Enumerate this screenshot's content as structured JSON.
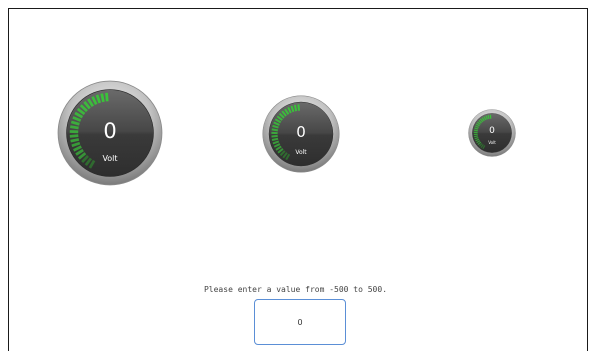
{
  "gauges": [
    {
      "id": "large",
      "value": "0",
      "unit": "Volt",
      "level": 0
    },
    {
      "id": "medium",
      "value": "0",
      "unit": "Volt",
      "level": 0
    },
    {
      "id": "small",
      "value": "0",
      "unit": "Volt",
      "level": 0
    }
  ],
  "range": {
    "min": -500,
    "max": 500
  },
  "prompt": "Please enter a value from -500 to 500.",
  "input": {
    "value": "0"
  },
  "colors": {
    "tick_active": "#39c439",
    "face": "#4a4a4a",
    "bezel": "#b8b8b8",
    "input_border": "#5b8fd6"
  }
}
